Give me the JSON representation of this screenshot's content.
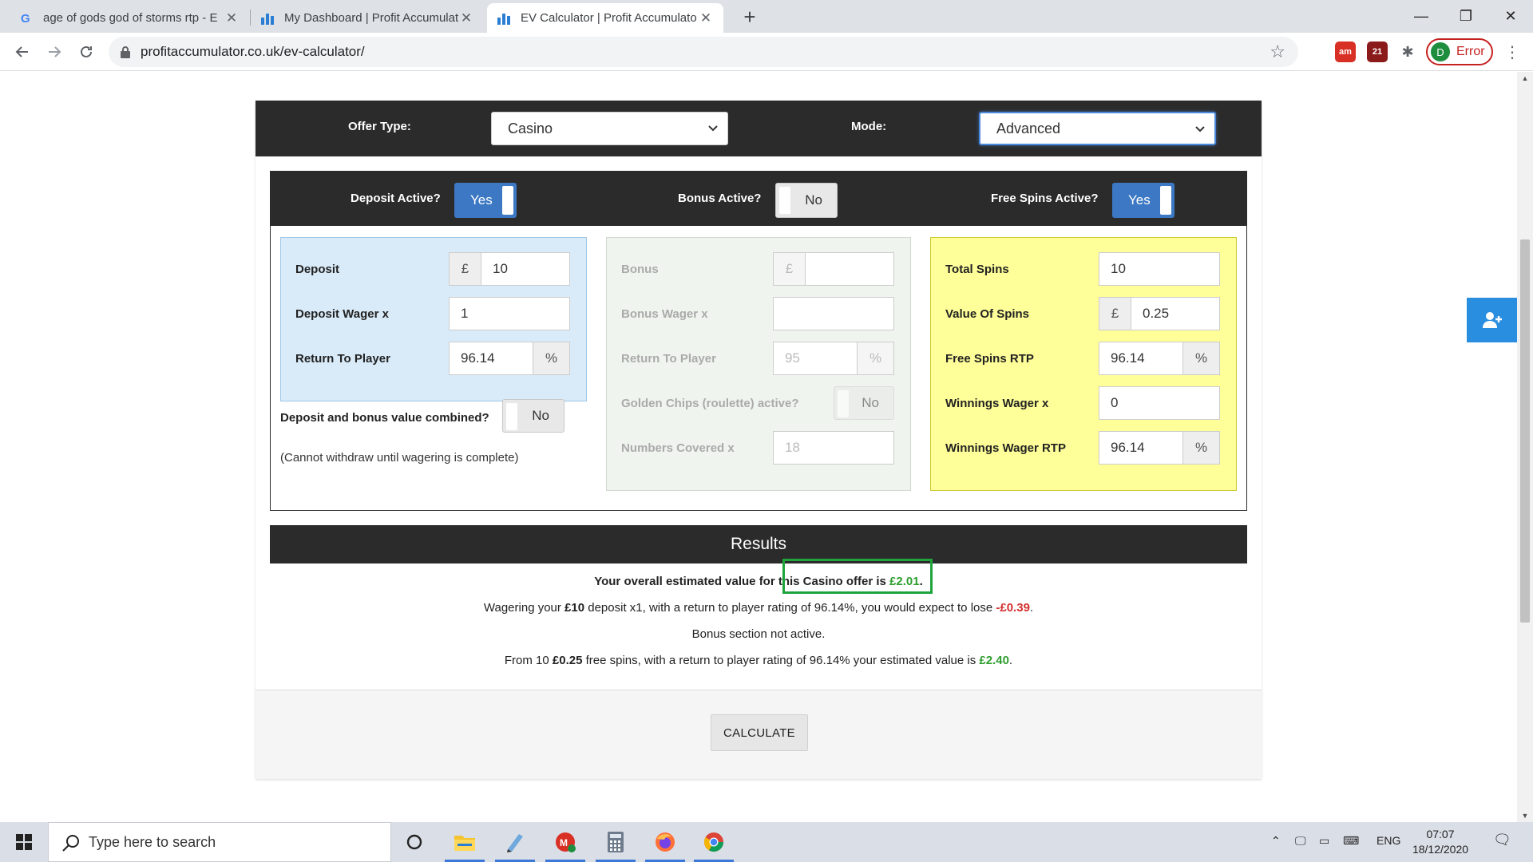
{
  "browser": {
    "tabs": [
      {
        "title": "age of gods god of storms rtp - E",
        "close": "✕"
      },
      {
        "title": "My Dashboard | Profit Accumulat",
        "close": "✕"
      },
      {
        "title": "EV Calculator | Profit Accumulato",
        "close": "✕"
      }
    ],
    "new_tab": "+",
    "window": {
      "minimize": "—",
      "maximize": "❐",
      "close": "✕"
    },
    "url": "profitaccumulator.co.uk/ev-calculator/",
    "extensions": {
      "badge_21": "21"
    },
    "profile": {
      "initial": "D",
      "status": "Error"
    }
  },
  "calculator": {
    "offer_type_label": "Offer Type:",
    "offer_type_value": "Casino",
    "mode_label": "Mode:",
    "mode_value": "Advanced",
    "toggles": {
      "deposit_label": "Deposit Active?",
      "deposit_value": "Yes",
      "bonus_label": "Bonus Active?",
      "bonus_value": "No",
      "spins_label": "Free Spins Active?",
      "spins_value": "Yes"
    },
    "deposit_panel": {
      "deposit_label": "Deposit",
      "deposit_currency": "£",
      "deposit_value": "10",
      "wager_label": "Deposit Wager x",
      "wager_value": "1",
      "rtp_label": "Return To Player",
      "rtp_value": "96.14",
      "rtp_unit": "%"
    },
    "combined_label": "Deposit and bonus value combined?",
    "combined_value": "No",
    "combined_note": "(Cannot withdraw until wagering is complete)",
    "bonus_panel": {
      "bonus_label": "Bonus",
      "bonus_currency": "£",
      "bonus_value": "",
      "wager_label": "Bonus Wager x",
      "wager_value": "",
      "rtp_label": "Return To Player",
      "rtp_value": "95",
      "rtp_unit": "%",
      "chips_label": "Golden Chips (roulette) active?",
      "chips_value": "No",
      "numbers_label": "Numbers Covered x",
      "numbers_value": "18"
    },
    "spins_panel": {
      "total_label": "Total Spins",
      "total_value": "10",
      "value_label": "Value Of Spins",
      "value_currency": "£",
      "value_value": "0.25",
      "rtp_label": "Free Spins RTP",
      "rtp_value": "96.14",
      "rtp_unit": "%",
      "wwager_label": "Winnings Wager x",
      "wwager_value": "0",
      "wrtp_label": "Winnings Wager RTP",
      "wrtp_value": "96.14",
      "wrtp_unit": "%"
    },
    "results": {
      "title": "Results",
      "line1_prefix": "Your overall estimated value for this Casino offer is ",
      "line1_value": "£2.01",
      "line1_suffix": ".",
      "line2_a": "Wagering your ",
      "line2_deposit": "£10",
      "line2_b": " deposit x1, with a return to player rating of 96.14%, you would expect to lose ",
      "line2_value": "-£0.39",
      "line2_suffix": ".",
      "line3": "Bonus section not active.",
      "line4_a": "From 10 ",
      "line4_spin": "£0.25",
      "line4_b": " free spins, with a return to player rating of 96.14% your estimated value is ",
      "line4_value": "£2.40",
      "line4_suffix": "."
    },
    "calculate_button": "CALCULATE"
  },
  "taskbar": {
    "search_placeholder": "Type here to search",
    "language": "ENG",
    "time": "07:07",
    "date": "18/12/2020"
  },
  "colors": {
    "accent_blue": "#3c78c3",
    "dark_bar": "#2b2b2b",
    "deposit_panel": "#d9ebf9",
    "spins_panel": "#ffff99",
    "positive": "#2e9e2e",
    "negative": "#d32f2f",
    "highlight_box": "#1fa33c"
  }
}
